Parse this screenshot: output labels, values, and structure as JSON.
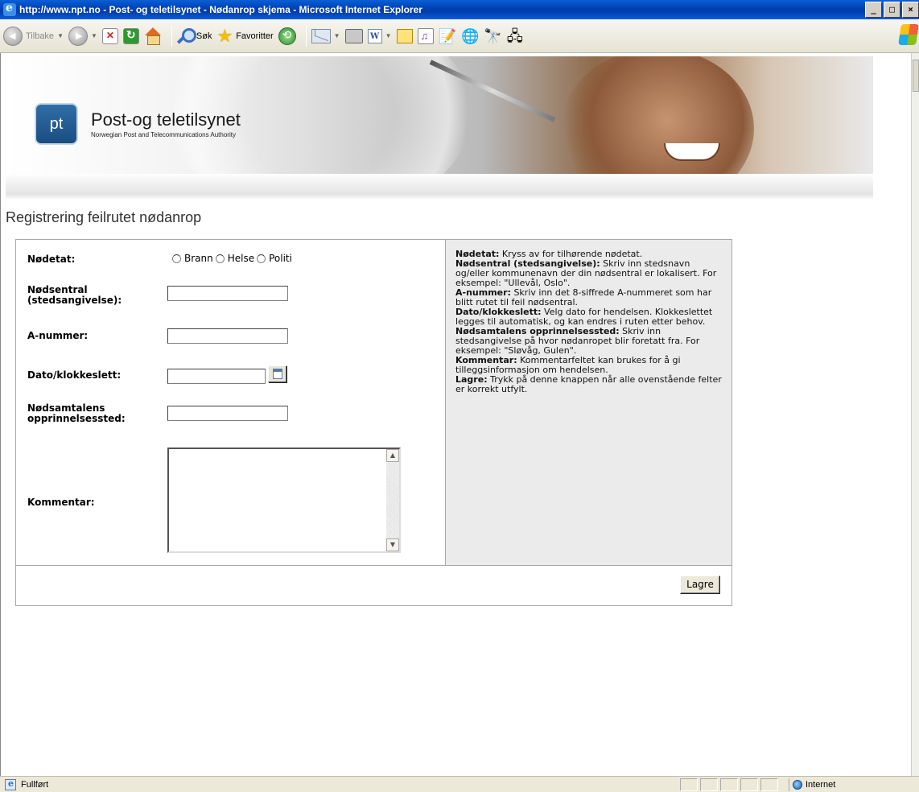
{
  "window": {
    "title": "http://www.npt.no - Post- og teletilsynet - Nødanrop skjema - Microsoft Internet Explorer",
    "controls": [
      "_",
      "□",
      "×"
    ]
  },
  "toolbar": {
    "back_label": "Tilbake",
    "search_label": "Søk",
    "favorites_label": "Favoritter"
  },
  "banner": {
    "logo_letters": "pt",
    "org_name": "Post-og teletilsynet",
    "org_subtitle": "Norwegian Post and Telecommunications Authority"
  },
  "page": {
    "title": "Registrering feilrutet nødanrop"
  },
  "form": {
    "nodetat_label": "Nødetat:",
    "radio_options": [
      "Brann",
      "Helse",
      "Politi"
    ],
    "nodsentral_label": "Nødsentral (stedsangivelse):",
    "anummer_label": "A-nummer:",
    "dato_label": "Dato/klokkeslett:",
    "opprinnelse_label": "Nødsamtalens opprinnelsessted:",
    "kommentar_label": "Kommentar:",
    "save_label": "Lagre"
  },
  "help": {
    "items": [
      {
        "term": "Nødetat:",
        "text": " Kryss av for tilhørende nødetat."
      },
      {
        "term": "Nødsentral (stedsangivelse):",
        "text": " Skriv inn stedsnavn og/eller kommunenavn der din nødsentral er lokalisert. For eksempel: \"Ullevål, Oslo\"."
      },
      {
        "term": "A-nummer:",
        "text": " Skriv inn det 8-siffrede A-nummeret som har blitt rutet til feil nødsentral."
      },
      {
        "term": "Dato/klokkeslett:",
        "text": " Velg dato for hendelsen. Klokkeslettet legges til automatisk, og kan endres i ruten etter behov."
      },
      {
        "term": "Nødsamtalens opprinnelsessted:",
        "text": " Skriv inn stedsangivelse på hvor nødanropet blir foretatt fra. For eksempel: \"Sløvåg, Gulen\"."
      },
      {
        "term": "Kommentar:",
        "text": " Kommentarfeltet kan brukes for å gi tilleggsinformasjon om hendelsen."
      },
      {
        "term": "Lagre:",
        "text": " Trykk på denne knappen når alle ovenstående felter er korrekt utfylt."
      }
    ]
  },
  "statusbar": {
    "status": "Fullført",
    "zone": "Internet"
  }
}
